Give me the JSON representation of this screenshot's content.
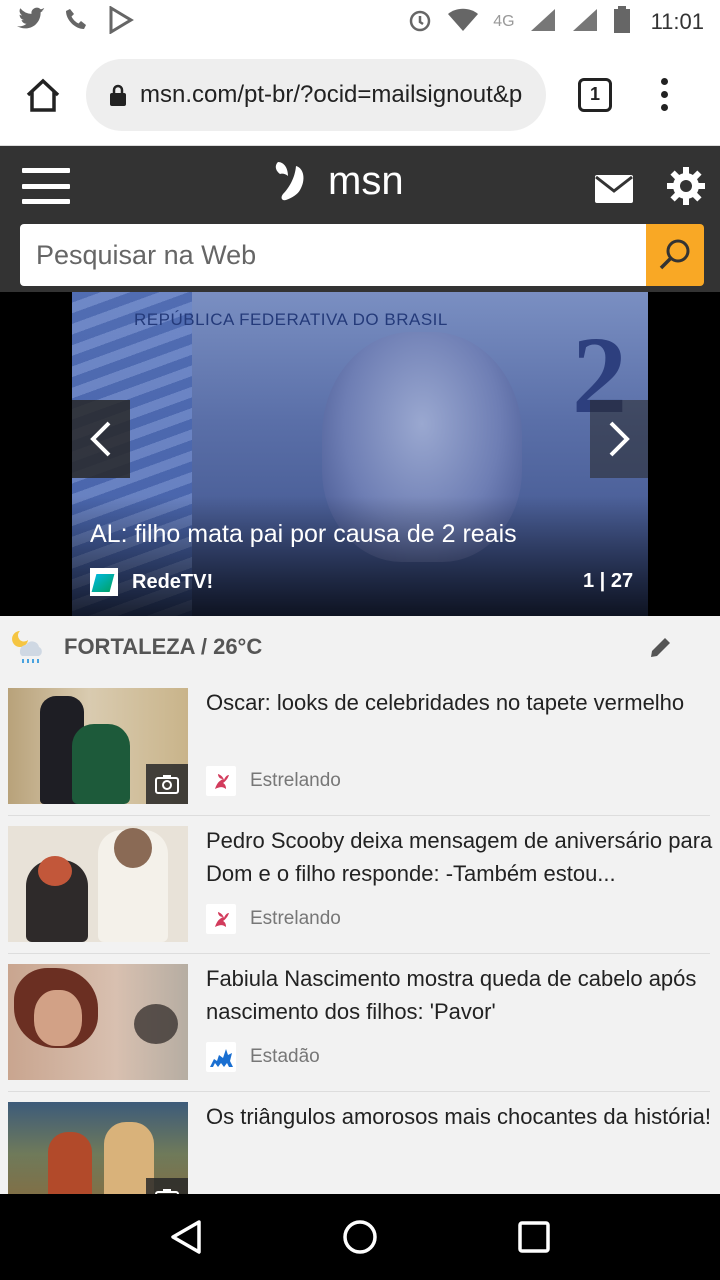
{
  "status_bar": {
    "time": "11:01",
    "network": "4G"
  },
  "browser": {
    "url": "msn.com/pt-br/?ocid=mailsignout&p",
    "tab_count": "1"
  },
  "msn": {
    "logo_text": "msn",
    "search_placeholder": "Pesquisar na Web"
  },
  "hero": {
    "headline": "AL: filho mata pai por causa de 2 reais",
    "source": "RedeTV!",
    "counter": "1 | 27",
    "banner_text": "REPÚBLICA FEDERATIVA DO BRASIL",
    "note_value": "2"
  },
  "weather": {
    "label": "FORTALEZA / 26°C"
  },
  "feed": [
    {
      "title": "Oscar: looks de celebridades no tapete vermelho",
      "source": "Estrelando",
      "gallery": true
    },
    {
      "title": "Pedro Scooby deixa mensagem de aniversário para Dom e o filho responde: -Também estou...",
      "source": "Estrelando",
      "gallery": false
    },
    {
      "title": "Fabiula Nascimento mostra queda de cabelo após nascimento dos filhos: 'Pavor'",
      "source": "Estadão",
      "gallery": false
    },
    {
      "title": "Os triângulos amorosos mais chocantes da história!",
      "source": "",
      "gallery": true
    }
  ],
  "colors": {
    "msn_header": "#333333",
    "search_button": "#f9a825"
  }
}
